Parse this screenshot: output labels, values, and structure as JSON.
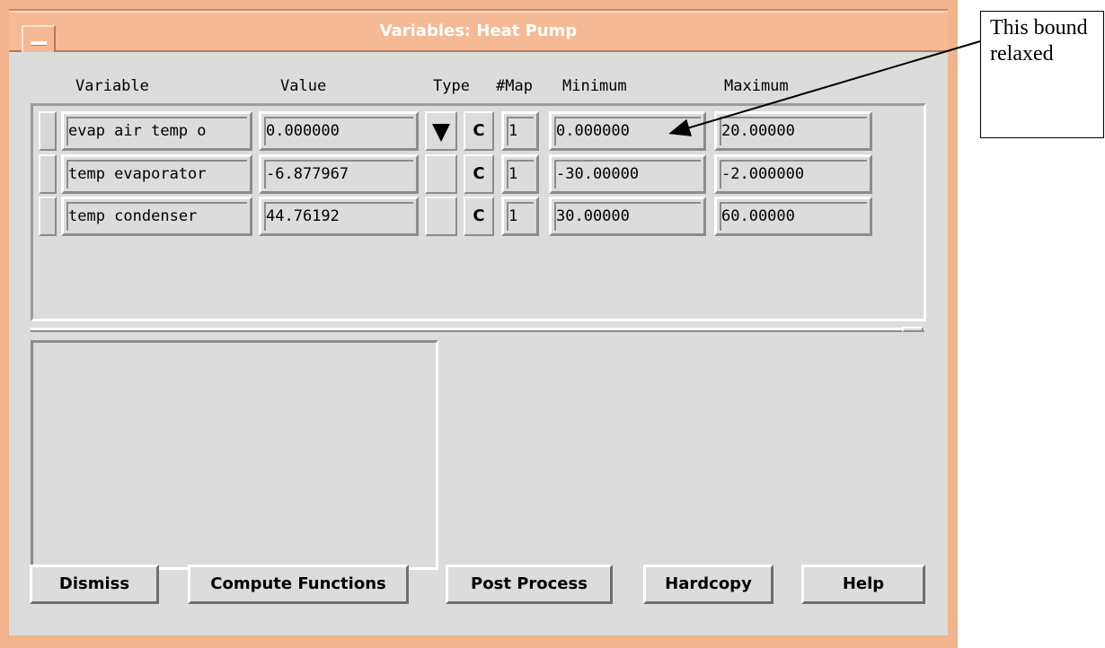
{
  "window": {
    "title": "Variables: Heat Pump"
  },
  "columns": {
    "variable": "Variable",
    "value": "Value",
    "type": "Type",
    "map": "#Map",
    "minimum": "Minimum",
    "maximum": "Maximum"
  },
  "rows": [
    {
      "variable": "evap air temp o",
      "value": "0.000000",
      "type_icon": "down-triangle-icon",
      "c_label": "C",
      "map": "1",
      "minimum": "0.000000",
      "maximum": "20.00000"
    },
    {
      "variable": "temp evaporator",
      "value": "-6.877967",
      "type_icon": "",
      "c_label": "C",
      "map": "1",
      "minimum": "-30.00000",
      "maximum": "-2.000000"
    },
    {
      "variable": "temp condenser",
      "value": "44.76192",
      "type_icon": "",
      "c_label": "C",
      "map": "1",
      "minimum": "30.00000",
      "maximum": "60.00000"
    }
  ],
  "buttons": {
    "dismiss": "Dismiss",
    "compute": "Compute Functions",
    "post": "Post Process",
    "hardcopy": "Hardcopy",
    "help": "Help"
  },
  "callout": {
    "text": "This bound relaxed"
  },
  "colors": {
    "title_bar": "#f5b994",
    "client_bg": "#dcdcdc"
  }
}
